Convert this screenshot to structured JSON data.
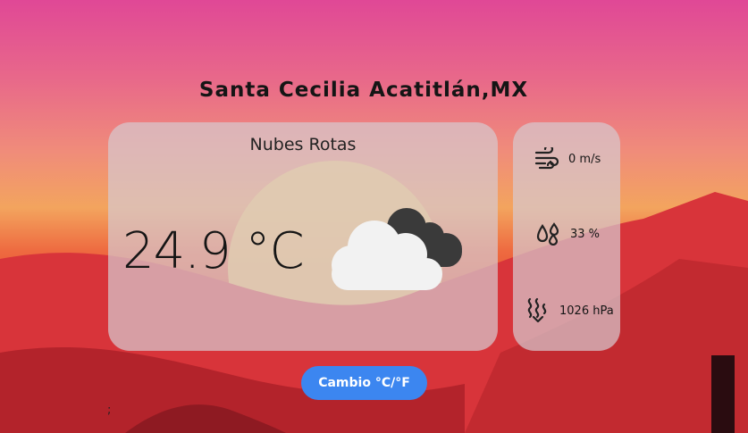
{
  "location": {
    "title": "Santa Cecilia Acatitlán,MX"
  },
  "weather": {
    "description": "Nubes Rotas",
    "temperature": "24.9 °C",
    "icon": "broken-clouds-icon"
  },
  "details": {
    "wind": {
      "value": "0 m/s",
      "icon": "wind-icon"
    },
    "humidity": {
      "value": "33 %",
      "icon": "humidity-drops-icon"
    },
    "pressure": {
      "value": "1026 hPa",
      "icon": "pressure-icon"
    }
  },
  "toggle": {
    "label": "Cambio °C/°F"
  },
  "stray_text": ";"
}
